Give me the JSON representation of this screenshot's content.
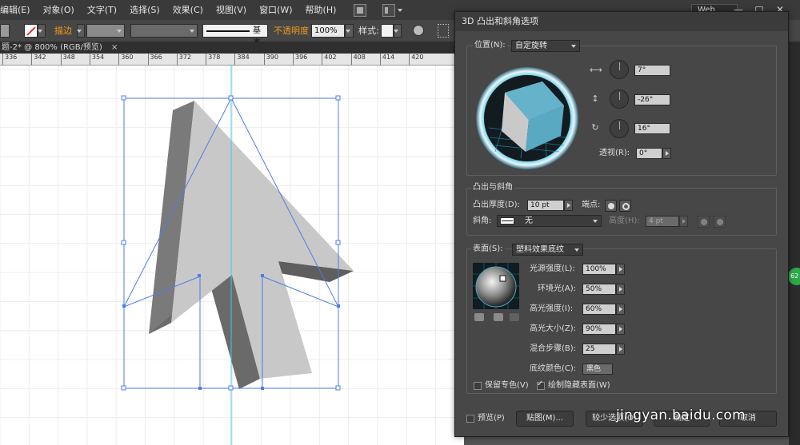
{
  "menubar": {
    "items": [
      "编辑(E)",
      "对象(O)",
      "文字(T)",
      "选择(S)",
      "效果(C)",
      "视图(V)",
      "窗口(W)",
      "帮助(H)"
    ],
    "workspace": "Web",
    "window_buttons": [
      "—",
      "□",
      "✕"
    ]
  },
  "controlbar": {
    "stroke_label": "描边",
    "stroke_profile": "基本",
    "opacity_label": "不透明度",
    "opacity_value": "100%",
    "style_label": "样式:"
  },
  "document_tab": {
    "title": "题-2* @ 800% (RGB/预览)",
    "close": "×"
  },
  "ruler": {
    "labels": [
      "336",
      "342",
      "348",
      "354",
      "360",
      "366",
      "372",
      "378",
      "384",
      "390",
      "396",
      "402",
      "408",
      "414",
      "420"
    ]
  },
  "dialog": {
    "title": "3D 凸出和斜角选项",
    "position": {
      "label": "位置(N):",
      "value": "自定旋转",
      "rot_x": "7°",
      "rot_y": "-26°",
      "rot_z": "16°",
      "perspective_label": "透视(R):",
      "perspective_value": "0°"
    },
    "extrude": {
      "section_label": "凸出与斜角",
      "depth_label": "凸出厚度(D):",
      "depth_value": "10 pt",
      "cap_label": "端点:",
      "bevel_label": "斜角:",
      "bevel_value": "无",
      "height_label": "高度(H):",
      "height_value": "4 pt"
    },
    "surface": {
      "label": "表面(S):",
      "value": "塑料效果底纹",
      "light_intensity_label": "光源强度(L):",
      "light_intensity_value": "100%",
      "ambient_label": "环境光(A):",
      "ambient_value": "50%",
      "highlight_intensity_label": "高光强度(I):",
      "highlight_intensity_value": "60%",
      "highlight_size_label": "高光大小(Z):",
      "highlight_size_value": "90%",
      "blend_steps_label": "混合步骤(B):",
      "blend_steps_value": "25",
      "shading_color_label": "底纹颜色(C):",
      "shading_color_value": "黑色",
      "preserve_spot_label": "保留专色(V)",
      "draw_hidden_label": "绘制隐藏表面(W)"
    },
    "footer": {
      "preview_label": "预览(P)",
      "map_button": "贴图(M)...",
      "fewer_options_button": "较少选项(O)",
      "ok_button": "确定",
      "cancel_button": "取消"
    }
  },
  "badge": "62",
  "watermark": "jingyan.baidu.com"
}
